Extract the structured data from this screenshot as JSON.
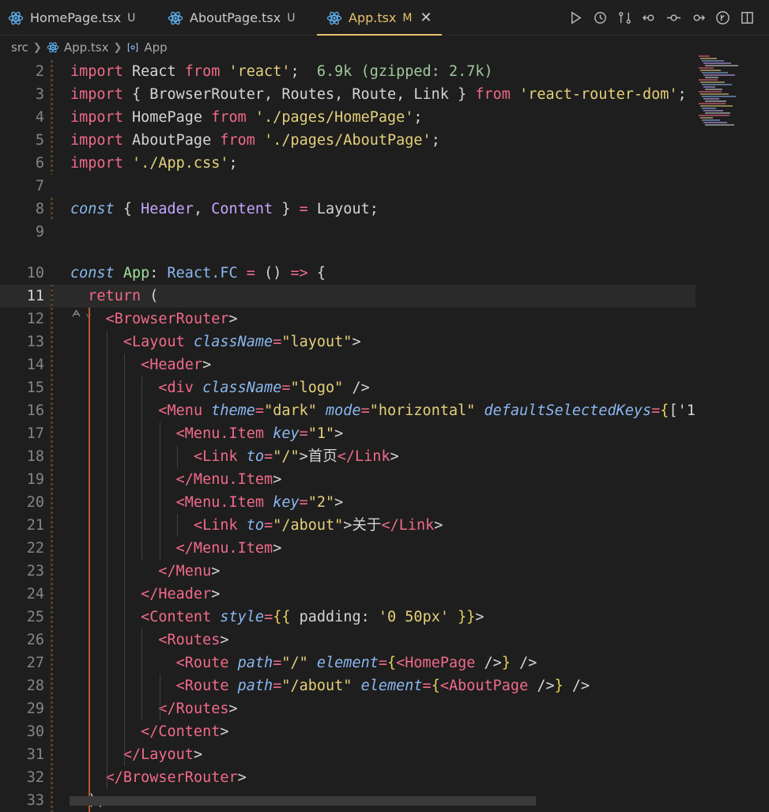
{
  "tabs": [
    {
      "label": "HomePage.tsx",
      "status": "U",
      "active": false
    },
    {
      "label": "AboutPage.tsx",
      "status": "U",
      "active": false
    },
    {
      "label": "App.tsx",
      "status": "M",
      "active": true,
      "close": "✕"
    }
  ],
  "actions": [
    "run-icon",
    "timeline-icon",
    "compare-icon",
    "go-back-icon",
    "commit-icon",
    "go-forward-icon",
    "git-graph-icon",
    "split-editor-icon"
  ],
  "breadcrumb": {
    "folder": "src",
    "file": "App.tsx",
    "symbol": "App"
  },
  "lines": [
    {
      "n": "2",
      "tokens": [
        [
          "kw",
          "import "
        ],
        [
          "pn",
          "React "
        ],
        [
          "kw",
          "from "
        ],
        [
          "str",
          "'react'"
        ],
        [
          "pn",
          ";  "
        ],
        [
          "hint",
          "6.9k (gzipped: 2.7k)"
        ]
      ]
    },
    {
      "n": "3",
      "tokens": [
        [
          "kw",
          "import "
        ],
        [
          "pn",
          "{ BrowserRouter, Routes, Route, Link } "
        ],
        [
          "kw",
          "from "
        ],
        [
          "str",
          "'react-router-dom'"
        ],
        [
          "pn",
          ";"
        ]
      ]
    },
    {
      "n": "4",
      "tokens": [
        [
          "kw",
          "import "
        ],
        [
          "pn",
          "HomePage "
        ],
        [
          "kw",
          "from "
        ],
        [
          "str",
          "'./pages/HomePage'"
        ],
        [
          "pn",
          ";"
        ]
      ]
    },
    {
      "n": "5",
      "tokens": [
        [
          "kw",
          "import "
        ],
        [
          "pn",
          "AboutPage "
        ],
        [
          "kw",
          "from "
        ],
        [
          "str",
          "'./pages/AboutPage'"
        ],
        [
          "pn",
          ";"
        ]
      ]
    },
    {
      "n": "6",
      "tokens": [
        [
          "kw",
          "import "
        ],
        [
          "str",
          "'./App.css'"
        ],
        [
          "pn",
          ";"
        ]
      ]
    },
    {
      "n": "7",
      "tokens": []
    },
    {
      "n": "8",
      "tokens": [
        [
          "it",
          "const "
        ],
        [
          "pn",
          "{ "
        ],
        [
          "comp",
          "Header"
        ],
        [
          "pn",
          ", "
        ],
        [
          "comp",
          "Content"
        ],
        [
          "pn",
          " } "
        ],
        [
          "op",
          "= "
        ],
        [
          "pn",
          "Layout;"
        ]
      ]
    },
    {
      "n": "9",
      "tokens": []
    },
    {
      "n": "10",
      "tokens": [
        [
          "it",
          "const "
        ],
        [
          "fn",
          "App"
        ],
        [
          "pn",
          ": "
        ],
        [
          "ty",
          "React.FC"
        ],
        [
          "op",
          " = "
        ],
        [
          "pn",
          "() "
        ],
        [
          "op",
          "=> "
        ],
        [
          "pn",
          "{"
        ]
      ]
    },
    {
      "n": "11",
      "tokens": [
        [
          "pn",
          "  "
        ],
        [
          "kw",
          "return "
        ],
        [
          "pn",
          "("
        ]
      ]
    },
    {
      "n": "12",
      "tokens": [
        [
          "pn",
          "    "
        ],
        [
          "tag",
          "<BrowserRouter"
        ],
        [
          "pn",
          ">"
        ]
      ]
    },
    {
      "n": "13",
      "tokens": [
        [
          "pn",
          "      "
        ],
        [
          "tag",
          "<Layout "
        ],
        [
          "attr",
          "className"
        ],
        [
          "op",
          "="
        ],
        [
          "str",
          "\"layout\""
        ],
        [
          "pn",
          ">"
        ]
      ]
    },
    {
      "n": "14",
      "tokens": [
        [
          "pn",
          "        "
        ],
        [
          "tag",
          "<Header"
        ],
        [
          "pn",
          ">"
        ]
      ]
    },
    {
      "n": "15",
      "tokens": [
        [
          "pn",
          "          "
        ],
        [
          "tag",
          "<div "
        ],
        [
          "attr",
          "className"
        ],
        [
          "op",
          "="
        ],
        [
          "str",
          "\"logo\""
        ],
        [
          "pn",
          " />"
        ]
      ]
    },
    {
      "n": "16",
      "tokens": [
        [
          "pn",
          "          "
        ],
        [
          "tag",
          "<Menu "
        ],
        [
          "attr",
          "theme"
        ],
        [
          "op",
          "="
        ],
        [
          "str",
          "\"dark\" "
        ],
        [
          "attr",
          "mode"
        ],
        [
          "op",
          "="
        ],
        [
          "str",
          "\"horizontal\" "
        ],
        [
          "attr",
          "defaultSelectedKeys"
        ],
        [
          "op",
          "="
        ],
        [
          "br",
          "{"
        ],
        [
          "pn",
          "['1"
        ]
      ]
    },
    {
      "n": "17",
      "tokens": [
        [
          "pn",
          "            "
        ],
        [
          "tag",
          "<Menu.Item "
        ],
        [
          "attr",
          "key"
        ],
        [
          "op",
          "="
        ],
        [
          "str",
          "\"1\""
        ],
        [
          "pn",
          ">"
        ]
      ]
    },
    {
      "n": "18",
      "tokens": [
        [
          "pn",
          "              "
        ],
        [
          "tag",
          "<Link "
        ],
        [
          "attr",
          "to"
        ],
        [
          "op",
          "="
        ],
        [
          "str",
          "\"/\""
        ],
        [
          "pn",
          ">首页"
        ],
        [
          "tag",
          "</Link"
        ],
        [
          "pn",
          ">"
        ]
      ]
    },
    {
      "n": "19",
      "tokens": [
        [
          "pn",
          "            "
        ],
        [
          "tag",
          "</Menu.Item"
        ],
        [
          "pn",
          ">"
        ]
      ]
    },
    {
      "n": "20",
      "tokens": [
        [
          "pn",
          "            "
        ],
        [
          "tag",
          "<Menu.Item "
        ],
        [
          "attr",
          "key"
        ],
        [
          "op",
          "="
        ],
        [
          "str",
          "\"2\""
        ],
        [
          "pn",
          ">"
        ]
      ]
    },
    {
      "n": "21",
      "tokens": [
        [
          "pn",
          "              "
        ],
        [
          "tag",
          "<Link "
        ],
        [
          "attr",
          "to"
        ],
        [
          "op",
          "="
        ],
        [
          "str",
          "\"/about\""
        ],
        [
          "pn",
          ">关于"
        ],
        [
          "tag",
          "</Link"
        ],
        [
          "pn",
          ">"
        ]
      ]
    },
    {
      "n": "22",
      "tokens": [
        [
          "pn",
          "            "
        ],
        [
          "tag",
          "</Menu.Item"
        ],
        [
          "pn",
          ">"
        ]
      ]
    },
    {
      "n": "23",
      "tokens": [
        [
          "pn",
          "          "
        ],
        [
          "tag",
          "</Menu"
        ],
        [
          "pn",
          ">"
        ]
      ]
    },
    {
      "n": "24",
      "tokens": [
        [
          "pn",
          "        "
        ],
        [
          "tag",
          "</Header"
        ],
        [
          "pn",
          ">"
        ]
      ]
    },
    {
      "n": "25",
      "tokens": [
        [
          "pn",
          "        "
        ],
        [
          "tag",
          "<Content "
        ],
        [
          "attr",
          "style"
        ],
        [
          "op",
          "="
        ],
        [
          "br",
          "{{ "
        ],
        [
          "pn",
          "padding: "
        ],
        [
          "str",
          "'0 50px'"
        ],
        [
          "br",
          " }}"
        ],
        [
          "pn",
          ">"
        ]
      ]
    },
    {
      "n": "26",
      "tokens": [
        [
          "pn",
          "          "
        ],
        [
          "tag",
          "<Routes"
        ],
        [
          "pn",
          ">"
        ]
      ]
    },
    {
      "n": "27",
      "tokens": [
        [
          "pn",
          "            "
        ],
        [
          "tag",
          "<Route "
        ],
        [
          "attr",
          "path"
        ],
        [
          "op",
          "="
        ],
        [
          "str",
          "\"/\" "
        ],
        [
          "attr",
          "element"
        ],
        [
          "op",
          "="
        ],
        [
          "br",
          "{"
        ],
        [
          "tag",
          "<HomePage "
        ],
        [
          "pn",
          "/>"
        ],
        [
          "br",
          "}"
        ],
        [
          "pn",
          " />"
        ]
      ]
    },
    {
      "n": "28",
      "tokens": [
        [
          "pn",
          "            "
        ],
        [
          "tag",
          "<Route "
        ],
        [
          "attr",
          "path"
        ],
        [
          "op",
          "="
        ],
        [
          "str",
          "\"/about\" "
        ],
        [
          "attr",
          "element"
        ],
        [
          "op",
          "="
        ],
        [
          "br",
          "{"
        ],
        [
          "tag",
          "<AboutPage "
        ],
        [
          "pn",
          "/>"
        ],
        [
          "br",
          "}"
        ],
        [
          "pn",
          " />"
        ]
      ]
    },
    {
      "n": "29",
      "tokens": [
        [
          "pn",
          "          "
        ],
        [
          "tag",
          "</Routes"
        ],
        [
          "pn",
          ">"
        ]
      ]
    },
    {
      "n": "30",
      "tokens": [
        [
          "pn",
          "        "
        ],
        [
          "tag",
          "</Content"
        ],
        [
          "pn",
          ">"
        ]
      ]
    },
    {
      "n": "31",
      "tokens": [
        [
          "pn",
          "      "
        ],
        [
          "tag",
          "</Layout"
        ],
        [
          "pn",
          ">"
        ]
      ]
    },
    {
      "n": "32",
      "tokens": [
        [
          "pn",
          "    "
        ],
        [
          "tag",
          "</BrowserRouter"
        ],
        [
          "pn",
          ">"
        ]
      ]
    },
    {
      "n": "33",
      "tokens": [
        [
          "pn",
          "  );"
        ]
      ]
    }
  ],
  "current_line": "11",
  "codelens_icon": "codelens-icon"
}
